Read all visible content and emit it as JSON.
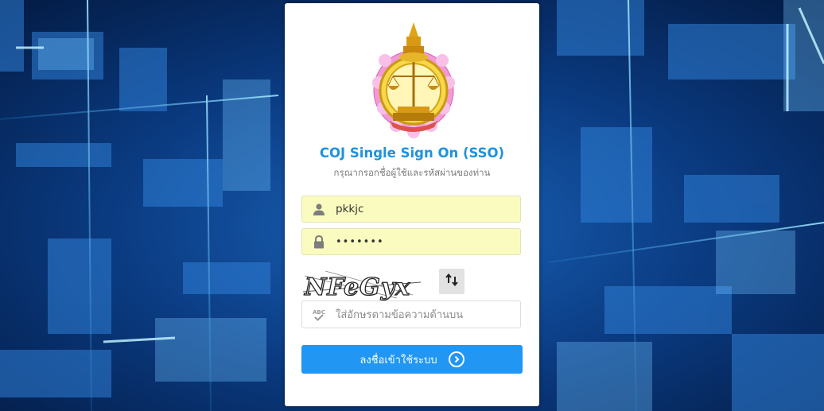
{
  "app": {
    "title": "COJ Single Sign On (SSO)",
    "subtitle": "กรุณากรอกชื่อผู้ใช้และรหัสผ่านของท่าน"
  },
  "login_form": {
    "username": {
      "value": "pkkjc",
      "icon": "user-icon"
    },
    "password": {
      "value": "•••••••",
      "icon": "lock-icon"
    },
    "captcha": {
      "text": "NFeGyx",
      "refresh_icon": "refresh-icon"
    },
    "captcha_input": {
      "placeholder": "ใส่อักษรตามข้อความด้านบน",
      "icon": "spellcheck-icon"
    },
    "submit_label": "ลงชื่อเข้าใช้ระบบ",
    "submit_icon": "circle-arrow-right-icon"
  },
  "colors": {
    "accent": "#1e93dc",
    "button": "#2196f3",
    "autofill": "#fafcbf"
  }
}
